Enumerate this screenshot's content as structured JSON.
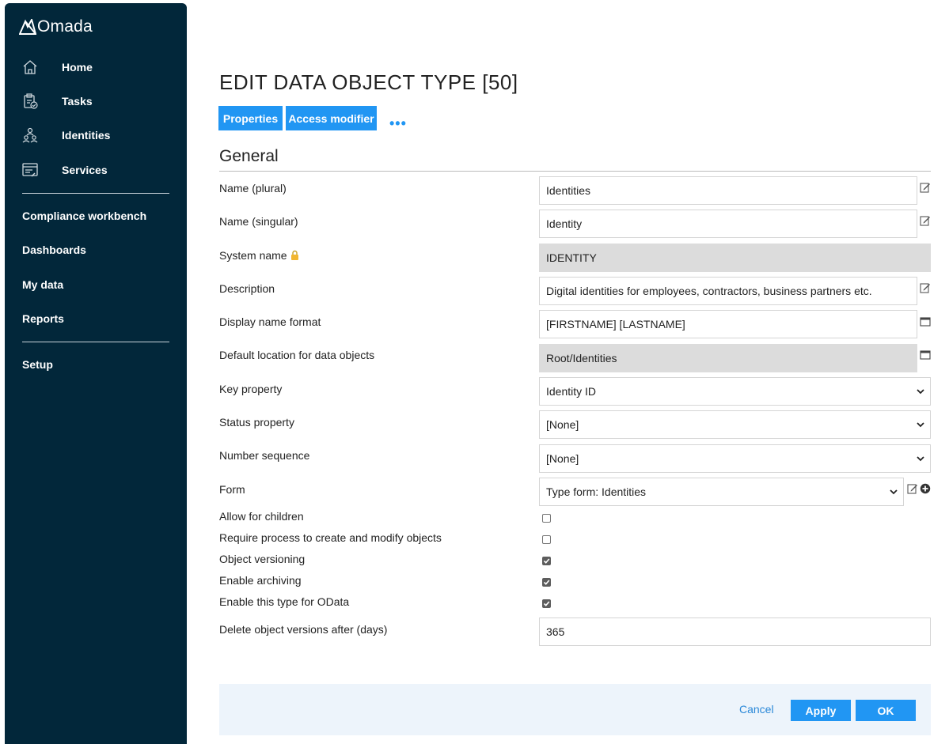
{
  "app": {
    "logo_text": "Omada"
  },
  "sidebar": {
    "items": [
      {
        "label": "Home",
        "icon": "home-icon"
      },
      {
        "label": "Tasks",
        "icon": "tasks-icon"
      },
      {
        "label": "Identities",
        "icon": "identities-icon"
      },
      {
        "label": "Services",
        "icon": "services-icon"
      }
    ],
    "links": [
      {
        "label": "Compliance workbench"
      },
      {
        "label": "Dashboards"
      },
      {
        "label": "My data"
      },
      {
        "label": "Reports"
      },
      {
        "label": "Setup"
      }
    ]
  },
  "page": {
    "title": "EDIT DATA OBJECT TYPE [50]",
    "tabs": [
      {
        "label": "Properties"
      },
      {
        "label": "Access modifier"
      }
    ],
    "more": "•••",
    "section": "General"
  },
  "form": {
    "name_plural": {
      "label": "Name (plural)",
      "value": "Identities"
    },
    "name_singular": {
      "label": "Name (singular)",
      "value": "Identity"
    },
    "system_name": {
      "label": "System name",
      "value": "IDENTITY"
    },
    "description": {
      "label": "Description",
      "value": "Digital identities for employees, contractors, business partners etc."
    },
    "display_name_format": {
      "label": "Display name format",
      "value": "[FIRSTNAME] [LASTNAME]"
    },
    "default_location": {
      "label": "Default location for data objects",
      "value": "Root/Identities"
    },
    "key_property": {
      "label": "Key property",
      "value": "Identity ID"
    },
    "status_property": {
      "label": "Status property",
      "value": "[None]"
    },
    "number_sequence": {
      "label": "Number sequence",
      "value": "[None]"
    },
    "form": {
      "label": "Form",
      "value": "Type form: Identities"
    },
    "allow_children": {
      "label": "Allow for children",
      "checked": false
    },
    "require_process": {
      "label": "Require process to create and modify objects",
      "checked": false
    },
    "object_versioning": {
      "label": "Object versioning",
      "checked": true
    },
    "enable_archiving": {
      "label": "Enable archiving",
      "checked": true
    },
    "enable_odata": {
      "label": "Enable this type for OData",
      "checked": true
    },
    "delete_versions": {
      "label": "Delete object versions after (days)",
      "value": "365"
    }
  },
  "footer": {
    "cancel": "Cancel",
    "apply": "Apply",
    "ok": "OK"
  },
  "colors": {
    "sidebar_bg": "#02273a",
    "accent": "#2196f3",
    "footer_bg": "#edf4fb",
    "readonly_bg": "#dcdcdc"
  }
}
